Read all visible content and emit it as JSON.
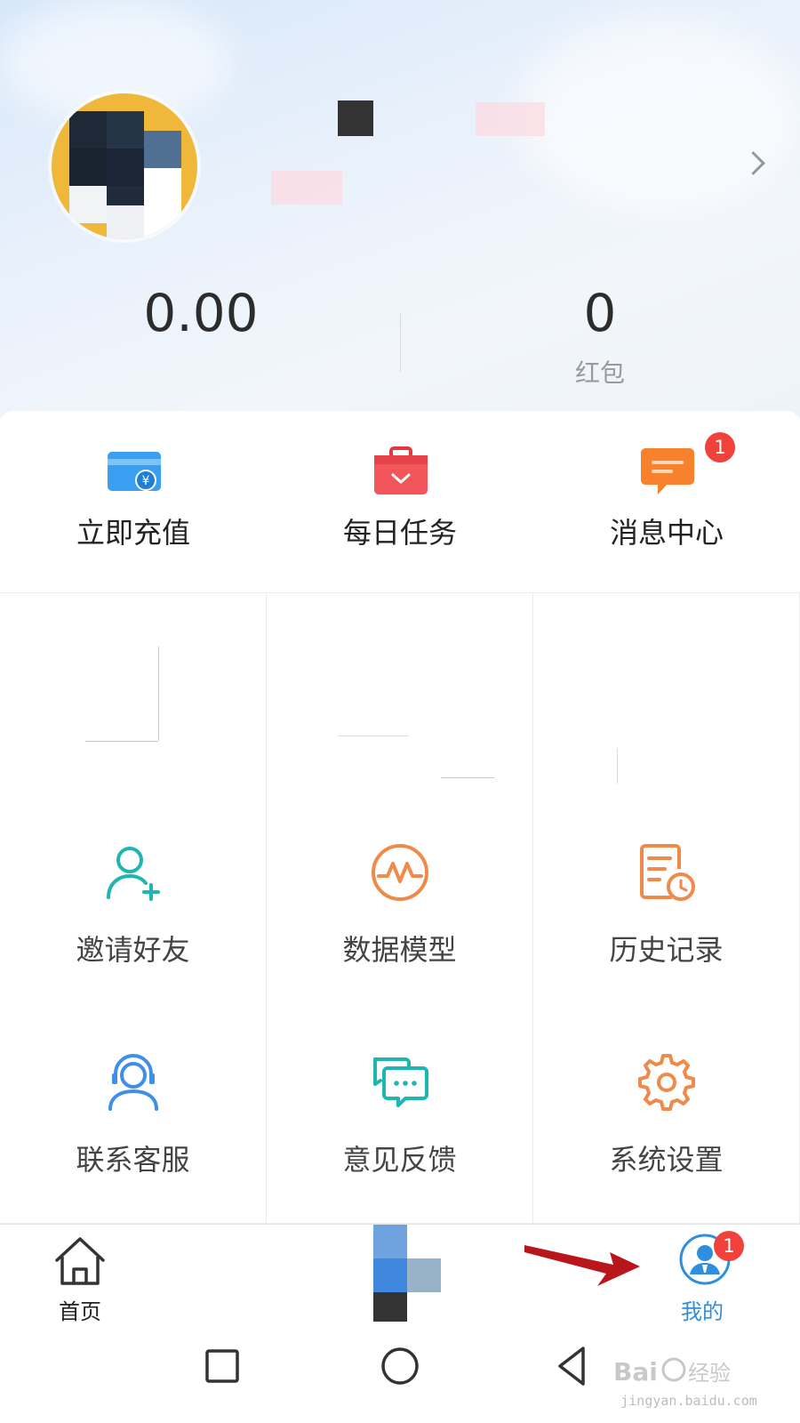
{
  "profile": {
    "balance": "0.00",
    "red_packet_count": "0",
    "red_packet_label": "红包"
  },
  "quick_actions": [
    {
      "label": "立即充值",
      "icon": "wallet-card-icon",
      "color": "#3a9ff0"
    },
    {
      "label": "每日任务",
      "icon": "task-bag-icon",
      "color": "#f2555a"
    },
    {
      "label": "消息中心",
      "icon": "message-icon",
      "color": "#f7812d",
      "badge": "1"
    }
  ],
  "grid": [
    {
      "label": "邀请好友",
      "icon": "invite-friend-icon",
      "color": "#1fb5b0"
    },
    {
      "label": "数据模型",
      "icon": "data-model-icon",
      "color": "#f08a4b"
    },
    {
      "label": "历史记录",
      "icon": "history-icon",
      "color": "#f08a4b"
    },
    {
      "label": "联系客服",
      "icon": "customer-service-icon",
      "color": "#3f8fe8"
    },
    {
      "label": "意见反馈",
      "icon": "feedback-icon",
      "color": "#1fb5b0"
    },
    {
      "label": "系统设置",
      "icon": "settings-gear-icon",
      "color": "#f08a4b"
    }
  ],
  "tabbar": {
    "home_label": "首页",
    "mine_label": "我的",
    "mine_badge": "1",
    "active_color": "#2f8fdc"
  },
  "watermark": {
    "brand": "Baidu经验",
    "url": "jingyan.baidu.com"
  }
}
